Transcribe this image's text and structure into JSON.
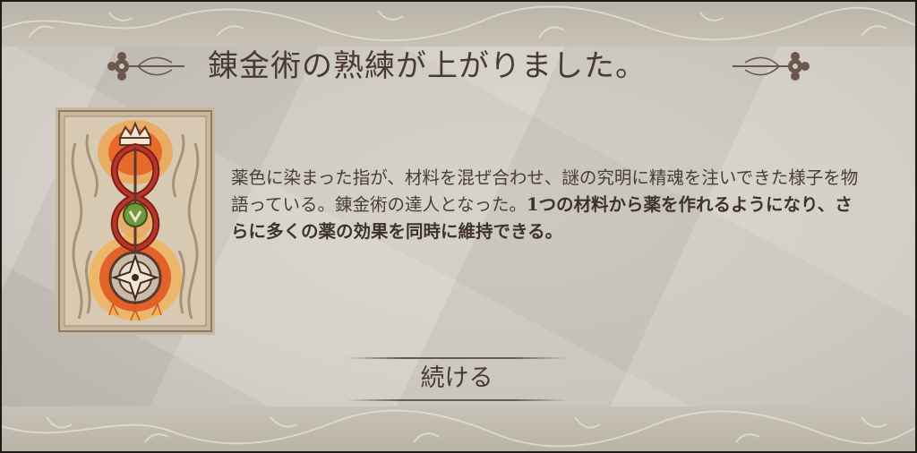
{
  "dialog": {
    "title": "錬金術の熟練が上がりました。",
    "description_plain": "薬色に染まった指が、材料を混ぜ合わせ、謎の究明に精魂を注いできた様子を物語っている。錬金術の達人となった。",
    "description_bold": "1つの材料から薬を作れるようになり、さらに多くの薬の効果を同時に維持できる。",
    "continue_label": "続ける",
    "card_icon": "alchemy-skill-card-icon"
  },
  "colors": {
    "parchment": "#d4d0c8",
    "text": "#4a3e36",
    "card_orange": "#e2622a",
    "card_green": "#6f9a3c"
  }
}
